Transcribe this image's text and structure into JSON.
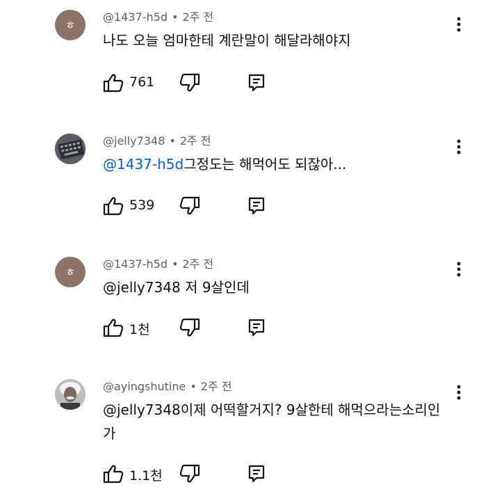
{
  "comments": [
    {
      "author": "@1437-h5d",
      "time": "2주 전",
      "avatar": {
        "type": "letter",
        "letter": "ㅎ",
        "color": "#8d7467"
      },
      "mention": "",
      "text": "나도 오늘 엄마한테 계란말이 해달라해야지",
      "likes": "761",
      "actions": {
        "like": "like-icon",
        "dislike": "dislike-icon",
        "reply": "reply-icon",
        "more": "more-vert-icon"
      }
    },
    {
      "author": "@jelly7348",
      "time": "2주 전",
      "avatar": {
        "type": "image",
        "description_icon": "keyboard-avatar"
      },
      "mention": "@1437-h5d",
      "text": "그정도는 해먹어도 되잖아...",
      "likes": "539"
    },
    {
      "author": "@1437-h5d",
      "time": "2주 전",
      "avatar": {
        "type": "letter",
        "letter": "ㅎ",
        "color": "#8d7467"
      },
      "mention": "",
      "text": "@jelly7348 저 9살인데",
      "likes": "1천"
    },
    {
      "author": "@ayingshutine",
      "time": "2주 전",
      "avatar": {
        "type": "image",
        "description_icon": "portrait-avatar"
      },
      "mention": "@jelly7348",
      "text": "이제 어떡할거지? 9살한테 해먹으라는소리인가",
      "likes": "1.1천"
    }
  ],
  "separator": "•",
  "colors": {
    "text": "#0f0f0f",
    "secondary": "#606060",
    "mention": "#065fd4"
  }
}
